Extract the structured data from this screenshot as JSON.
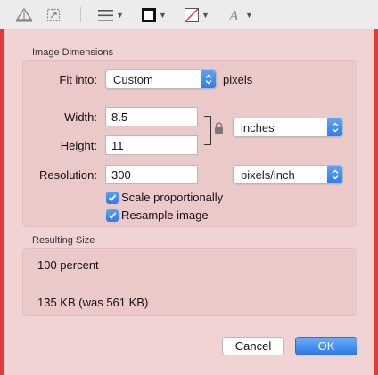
{
  "toolbar": {
    "icons": [
      "adjust-color-icon",
      "resize-icon",
      "shape-style-icon",
      "border-color-icon",
      "fill-color-icon",
      "text-style-icon"
    ]
  },
  "dimensions": {
    "group_title": "Image Dimensions",
    "fit_into_label": "Fit into:",
    "fit_into_value": "Custom",
    "fit_into_unit": "pixels",
    "width_label": "Width:",
    "width_value": "8.5",
    "height_label": "Height:",
    "height_value": "11",
    "size_unit_value": "inches",
    "resolution_label": "Resolution:",
    "resolution_value": "300",
    "resolution_unit_value": "pixels/inch",
    "scale_proportionally_label": "Scale proportionally",
    "scale_proportionally_checked": true,
    "resample_label": "Resample image",
    "resample_checked": true
  },
  "result": {
    "group_title": "Resulting Size",
    "percent_text": "100 percent",
    "size_text": "135 KB (was 561 KB)"
  },
  "buttons": {
    "cancel_label": "Cancel",
    "ok_label": "OK"
  },
  "colors": {
    "frame_red": "#e53a3a",
    "sheet_pink": "#f1d3d3",
    "accent_blue": "#2f7be8"
  }
}
